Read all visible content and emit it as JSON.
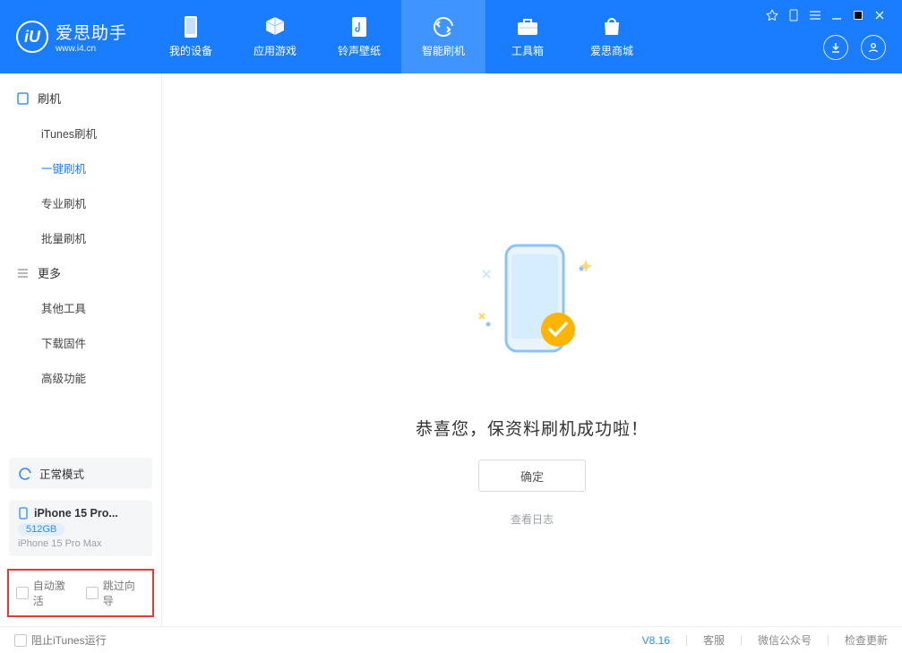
{
  "app": {
    "name": "爱思助手",
    "site": "www.i4.cn"
  },
  "nav": {
    "items": [
      {
        "label": "我的设备",
        "icon": "device-icon"
      },
      {
        "label": "应用游戏",
        "icon": "cube-icon"
      },
      {
        "label": "铃声壁纸",
        "icon": "music-icon"
      },
      {
        "label": "智能刷机",
        "icon": "refresh-icon"
      },
      {
        "label": "工具箱",
        "icon": "toolbox-icon"
      },
      {
        "label": "爱思商城",
        "icon": "bag-icon"
      }
    ],
    "active_index": 3
  },
  "sidebar": {
    "sections": [
      {
        "title": "刷机",
        "items": [
          "iTunes刷机",
          "一键刷机",
          "专业刷机",
          "批量刷机"
        ],
        "active_index": 1
      },
      {
        "title": "更多",
        "items": [
          "其他工具",
          "下载固件",
          "高级功能"
        ]
      }
    ],
    "mode": {
      "label": "正常模式",
      "icon": "refresh-mode-icon"
    },
    "device": {
      "name": "iPhone 15 Pro...",
      "storage": "512GB",
      "model": "iPhone 15 Pro Max"
    },
    "checks": {
      "auto_activate": "自动激活",
      "skip_guide": "跳过向导"
    }
  },
  "main": {
    "success_message": "恭喜您，保资料刷机成功啦！",
    "ok_button": "确定",
    "view_log": "查看日志"
  },
  "footer": {
    "block_itunes": "阻止iTunes运行",
    "version": "V8.16",
    "links": [
      "客服",
      "微信公众号",
      "检查更新"
    ]
  }
}
